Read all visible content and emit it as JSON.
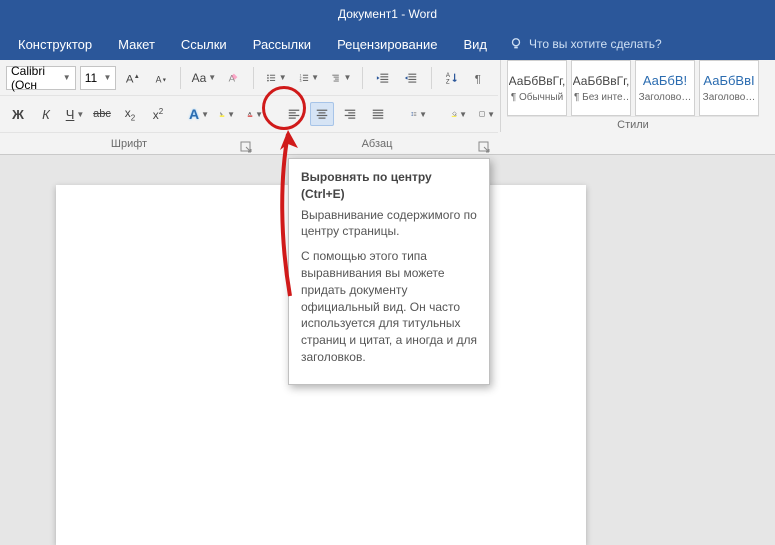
{
  "title": "Документ1  -  Word",
  "menus": {
    "items": [
      "Конструктор",
      "Макет",
      "Ссылки",
      "Рассылки",
      "Рецензирование",
      "Вид"
    ],
    "tellme": "Что вы хотите сделать?"
  },
  "font": {
    "name": "Calibri (Осн",
    "size": "11"
  },
  "format_marks": {
    "bold": "Ж",
    "italic": "К",
    "underline": "Ч",
    "strike": "abc",
    "subscript": "x",
    "superscript": "x",
    "fontcolor_letter": "A",
    "highlight_letter": "A",
    "texteffect_letter": "A",
    "clear_letter": "A",
    "changecase": "Aa"
  },
  "group_labels": {
    "font": "Шрифт",
    "paragraph": "Абзац",
    "styles": "Стили"
  },
  "styles": [
    {
      "preview": "АаБбВвГг,",
      "name": "¶ Обычный",
      "blue": false
    },
    {
      "preview": "АаБбВвГг,",
      "name": "¶ Без инте…",
      "blue": false
    },
    {
      "preview": "АаБбВ!",
      "name": "Заголово…",
      "blue": true
    },
    {
      "preview": "АаБбВвІ",
      "name": "Заголово…",
      "blue": true
    }
  ],
  "tooltip": {
    "title": "Выровнять по центру (Ctrl+E)",
    "p1": "Выравнивание содержимого по центру страницы.",
    "p2": "С помощью этого типа выравнивания вы можете придать документу официальный вид. Он часто используется для титульных страниц и цитат, а иногда и для заголовков."
  }
}
